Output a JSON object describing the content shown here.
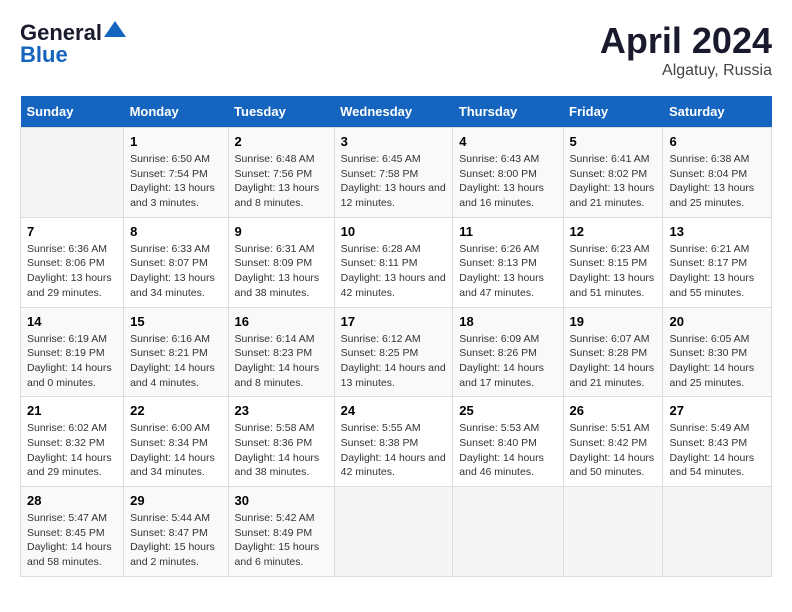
{
  "header": {
    "logo_line1": "General",
    "logo_line2": "Blue",
    "month_year": "April 2024",
    "location": "Algatuy, Russia"
  },
  "weekdays": [
    "Sunday",
    "Monday",
    "Tuesday",
    "Wednesday",
    "Thursday",
    "Friday",
    "Saturday"
  ],
  "weeks": [
    [
      {
        "day": "",
        "sunrise": "",
        "sunset": "",
        "daylight": ""
      },
      {
        "day": "1",
        "sunrise": "Sunrise: 6:50 AM",
        "sunset": "Sunset: 7:54 PM",
        "daylight": "Daylight: 13 hours and 3 minutes."
      },
      {
        "day": "2",
        "sunrise": "Sunrise: 6:48 AM",
        "sunset": "Sunset: 7:56 PM",
        "daylight": "Daylight: 13 hours and 8 minutes."
      },
      {
        "day": "3",
        "sunrise": "Sunrise: 6:45 AM",
        "sunset": "Sunset: 7:58 PM",
        "daylight": "Daylight: 13 hours and 12 minutes."
      },
      {
        "day": "4",
        "sunrise": "Sunrise: 6:43 AM",
        "sunset": "Sunset: 8:00 PM",
        "daylight": "Daylight: 13 hours and 16 minutes."
      },
      {
        "day": "5",
        "sunrise": "Sunrise: 6:41 AM",
        "sunset": "Sunset: 8:02 PM",
        "daylight": "Daylight: 13 hours and 21 minutes."
      },
      {
        "day": "6",
        "sunrise": "Sunrise: 6:38 AM",
        "sunset": "Sunset: 8:04 PM",
        "daylight": "Daylight: 13 hours and 25 minutes."
      }
    ],
    [
      {
        "day": "7",
        "sunrise": "Sunrise: 6:36 AM",
        "sunset": "Sunset: 8:06 PM",
        "daylight": "Daylight: 13 hours and 29 minutes."
      },
      {
        "day": "8",
        "sunrise": "Sunrise: 6:33 AM",
        "sunset": "Sunset: 8:07 PM",
        "daylight": "Daylight: 13 hours and 34 minutes."
      },
      {
        "day": "9",
        "sunrise": "Sunrise: 6:31 AM",
        "sunset": "Sunset: 8:09 PM",
        "daylight": "Daylight: 13 hours and 38 minutes."
      },
      {
        "day": "10",
        "sunrise": "Sunrise: 6:28 AM",
        "sunset": "Sunset: 8:11 PM",
        "daylight": "Daylight: 13 hours and 42 minutes."
      },
      {
        "day": "11",
        "sunrise": "Sunrise: 6:26 AM",
        "sunset": "Sunset: 8:13 PM",
        "daylight": "Daylight: 13 hours and 47 minutes."
      },
      {
        "day": "12",
        "sunrise": "Sunrise: 6:23 AM",
        "sunset": "Sunset: 8:15 PM",
        "daylight": "Daylight: 13 hours and 51 minutes."
      },
      {
        "day": "13",
        "sunrise": "Sunrise: 6:21 AM",
        "sunset": "Sunset: 8:17 PM",
        "daylight": "Daylight: 13 hours and 55 minutes."
      }
    ],
    [
      {
        "day": "14",
        "sunrise": "Sunrise: 6:19 AM",
        "sunset": "Sunset: 8:19 PM",
        "daylight": "Daylight: 14 hours and 0 minutes."
      },
      {
        "day": "15",
        "sunrise": "Sunrise: 6:16 AM",
        "sunset": "Sunset: 8:21 PM",
        "daylight": "Daylight: 14 hours and 4 minutes."
      },
      {
        "day": "16",
        "sunrise": "Sunrise: 6:14 AM",
        "sunset": "Sunset: 8:23 PM",
        "daylight": "Daylight: 14 hours and 8 minutes."
      },
      {
        "day": "17",
        "sunrise": "Sunrise: 6:12 AM",
        "sunset": "Sunset: 8:25 PM",
        "daylight": "Daylight: 14 hours and 13 minutes."
      },
      {
        "day": "18",
        "sunrise": "Sunrise: 6:09 AM",
        "sunset": "Sunset: 8:26 PM",
        "daylight": "Daylight: 14 hours and 17 minutes."
      },
      {
        "day": "19",
        "sunrise": "Sunrise: 6:07 AM",
        "sunset": "Sunset: 8:28 PM",
        "daylight": "Daylight: 14 hours and 21 minutes."
      },
      {
        "day": "20",
        "sunrise": "Sunrise: 6:05 AM",
        "sunset": "Sunset: 8:30 PM",
        "daylight": "Daylight: 14 hours and 25 minutes."
      }
    ],
    [
      {
        "day": "21",
        "sunrise": "Sunrise: 6:02 AM",
        "sunset": "Sunset: 8:32 PM",
        "daylight": "Daylight: 14 hours and 29 minutes."
      },
      {
        "day": "22",
        "sunrise": "Sunrise: 6:00 AM",
        "sunset": "Sunset: 8:34 PM",
        "daylight": "Daylight: 14 hours and 34 minutes."
      },
      {
        "day": "23",
        "sunrise": "Sunrise: 5:58 AM",
        "sunset": "Sunset: 8:36 PM",
        "daylight": "Daylight: 14 hours and 38 minutes."
      },
      {
        "day": "24",
        "sunrise": "Sunrise: 5:55 AM",
        "sunset": "Sunset: 8:38 PM",
        "daylight": "Daylight: 14 hours and 42 minutes."
      },
      {
        "day": "25",
        "sunrise": "Sunrise: 5:53 AM",
        "sunset": "Sunset: 8:40 PM",
        "daylight": "Daylight: 14 hours and 46 minutes."
      },
      {
        "day": "26",
        "sunrise": "Sunrise: 5:51 AM",
        "sunset": "Sunset: 8:42 PM",
        "daylight": "Daylight: 14 hours and 50 minutes."
      },
      {
        "day": "27",
        "sunrise": "Sunrise: 5:49 AM",
        "sunset": "Sunset: 8:43 PM",
        "daylight": "Daylight: 14 hours and 54 minutes."
      }
    ],
    [
      {
        "day": "28",
        "sunrise": "Sunrise: 5:47 AM",
        "sunset": "Sunset: 8:45 PM",
        "daylight": "Daylight: 14 hours and 58 minutes."
      },
      {
        "day": "29",
        "sunrise": "Sunrise: 5:44 AM",
        "sunset": "Sunset: 8:47 PM",
        "daylight": "Daylight: 15 hours and 2 minutes."
      },
      {
        "day": "30",
        "sunrise": "Sunrise: 5:42 AM",
        "sunset": "Sunset: 8:49 PM",
        "daylight": "Daylight: 15 hours and 6 minutes."
      },
      {
        "day": "",
        "sunrise": "",
        "sunset": "",
        "daylight": ""
      },
      {
        "day": "",
        "sunrise": "",
        "sunset": "",
        "daylight": ""
      },
      {
        "day": "",
        "sunrise": "",
        "sunset": "",
        "daylight": ""
      },
      {
        "day": "",
        "sunrise": "",
        "sunset": "",
        "daylight": ""
      }
    ]
  ]
}
